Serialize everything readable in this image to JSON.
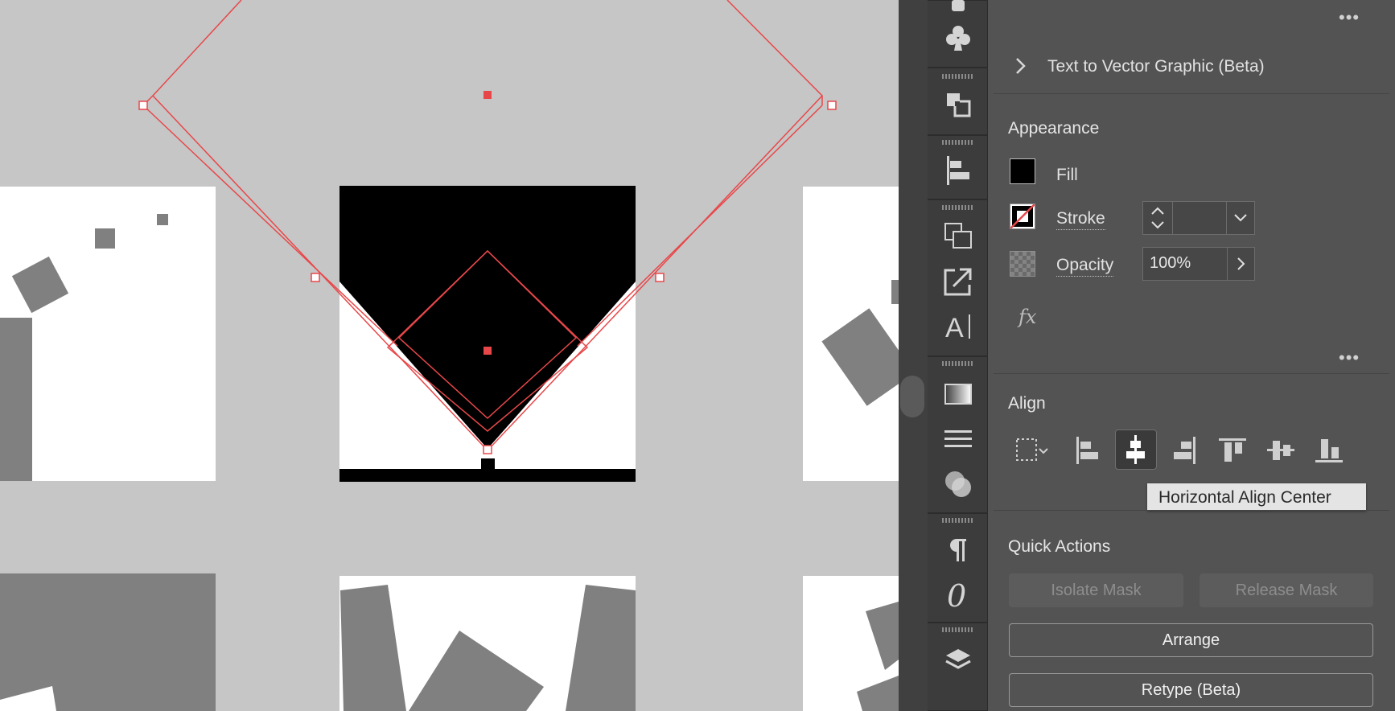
{
  "panel": {
    "text_to_vector": {
      "label": "Text to Vector Graphic (Beta)"
    },
    "appearance": {
      "title": "Appearance",
      "fill_label": "Fill",
      "stroke_label": "Stroke",
      "stroke_value": "",
      "opacity_label": "Opacity",
      "opacity_value": "100%",
      "fx_label": "fx"
    },
    "align": {
      "title": "Align",
      "buttons": [
        "align-to-selection",
        "horizontal-align-left",
        "horizontal-align-center",
        "horizontal-align-right",
        "vertical-align-top",
        "vertical-align-center",
        "vertical-align-bottom"
      ],
      "active": "horizontal-align-center",
      "tooltip": "Horizontal Align Center"
    },
    "quick_actions": {
      "title": "Quick Actions",
      "isolate_mask": "Isolate Mask",
      "release_mask": "Release Mask",
      "arrange": "Arrange",
      "retype": "Retype (Beta)"
    }
  },
  "toolbar": {
    "icons": [
      "club-symbol-icon",
      "pathfinder-icon",
      "align-icon",
      "transform-icon",
      "export-icon",
      "character-icon",
      "gradient-icon",
      "stroke-icon",
      "transparency-icon",
      "paragraph-icon",
      "opentype-icon",
      "layers-icon"
    ]
  },
  "colors": {
    "selection": "#e8474a",
    "canvas": "#c6c6c6",
    "panel": "#535353",
    "toolbar": "#3c3c3c"
  }
}
